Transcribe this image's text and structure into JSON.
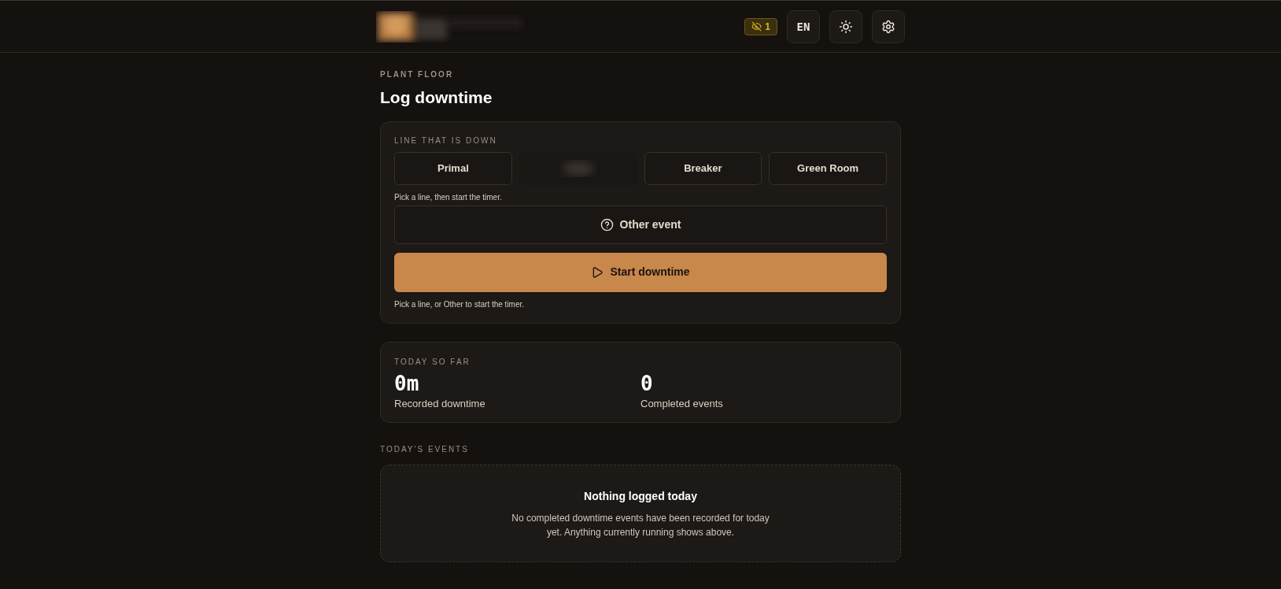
{
  "header": {
    "badge": {
      "count": "1"
    },
    "language": "EN"
  },
  "page": {
    "eyebrow": "PLANT FLOOR",
    "title": "Log downtime"
  },
  "line_card": {
    "label": "LINE THAT IS DOWN",
    "lines": [
      {
        "kind": "text",
        "label": "Primal"
      },
      {
        "kind": "redacted"
      },
      {
        "kind": "text",
        "label": "Breaker"
      },
      {
        "kind": "text",
        "label": "Green Room"
      }
    ],
    "line_hint": "Pick a line, then start the timer.",
    "other_button": "Other event",
    "start_button": "Start downtime",
    "start_hint": "Pick a line, or Other to start the timer."
  },
  "today": {
    "label": "TODAY SO FAR",
    "stats": [
      {
        "value": "0m",
        "label": "Recorded downtime"
      },
      {
        "value": "0",
        "label": "Completed events"
      }
    ]
  },
  "events": {
    "label": "TODAY'S EVENTS",
    "empty_title": "Nothing logged today",
    "empty_text": "No completed downtime events have been recorded for today yet. Anything currently running shows above."
  }
}
